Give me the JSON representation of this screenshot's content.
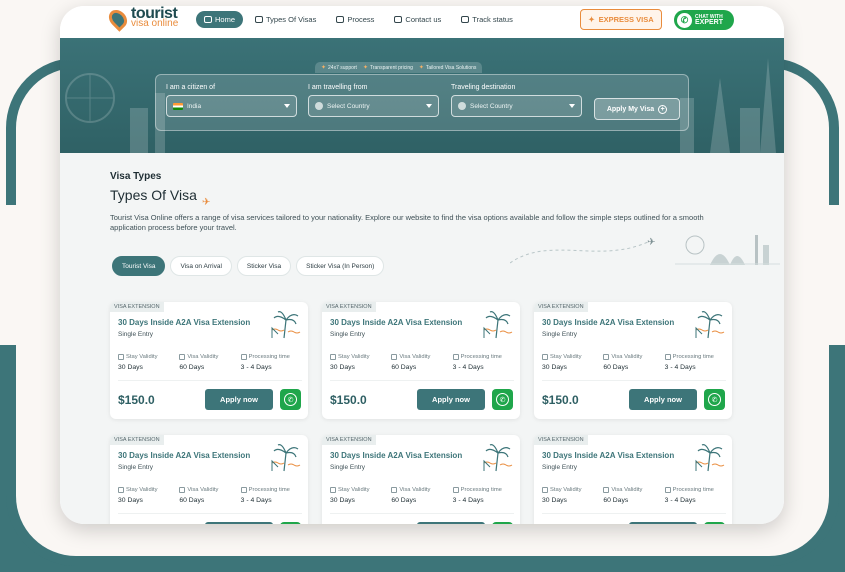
{
  "brand": {
    "name_line1": "tourist",
    "name_line2": "visa online"
  },
  "nav": {
    "items": [
      {
        "label": "Home",
        "active": true
      },
      {
        "label": "Types Of Visas",
        "active": false
      },
      {
        "label": "Process",
        "active": false
      },
      {
        "label": "Contact us",
        "active": false
      },
      {
        "label": "Track status",
        "active": false
      }
    ],
    "express_label": "EXPRESS VISA",
    "chat_line1": "CHAT WITH",
    "chat_line2": "EXPERT"
  },
  "hero": {
    "badges": [
      "24x7 support",
      "Transparent pricing",
      "Tailored Visa Solutions"
    ],
    "citizen": {
      "label": "I am a citizen of",
      "value": "India"
    },
    "from": {
      "label": "I am travelling from",
      "value": "Select Country"
    },
    "destination": {
      "label": "Traveling destination",
      "value": "Select Country"
    },
    "apply_label": "Apply My Visa"
  },
  "section": {
    "eyebrow": "Visa Types",
    "title": "Types Of Visa",
    "description": "Tourist Visa Online offers a range of visa services tailored to your nationality. Explore our website to find the visa options available and follow the simple steps outlined for a smooth application process before your travel."
  },
  "tabs": [
    {
      "label": "Tourist Visa",
      "active": true
    },
    {
      "label": "Visa on Arrival",
      "active": false
    },
    {
      "label": "Sticker Visa",
      "active": false
    },
    {
      "label": "Sticker Visa (In Person)",
      "active": false
    }
  ],
  "cards": [
    {
      "tag": "VISA EXTENSION",
      "title": "30 Days Inside A2A Visa Extension",
      "entry": "Single Entry",
      "stay_label": "Stay Validity",
      "stay": "30 Days",
      "validity_label": "Visa Validity",
      "validity": "60 Days",
      "processing_label": "Processing time",
      "processing": "3 - 4 Days",
      "price": "$150.0",
      "apply_label": "Apply now"
    },
    {
      "tag": "VISA EXTENSION",
      "title": "30 Days Inside A2A Visa Extension",
      "entry": "Single Entry",
      "stay_label": "Stay Validity",
      "stay": "30 Days",
      "validity_label": "Visa Validity",
      "validity": "60 Days",
      "processing_label": "Processing time",
      "processing": "3 - 4 Days",
      "price": "$150.0",
      "apply_label": "Apply now"
    },
    {
      "tag": "VISA EXTENSION",
      "title": "30 Days Inside A2A Visa Extension",
      "entry": "Single Entry",
      "stay_label": "Stay Validity",
      "stay": "30 Days",
      "validity_label": "Visa Validity",
      "validity": "60 Days",
      "processing_label": "Processing time",
      "processing": "3 - 4 Days",
      "price": "$150.0",
      "apply_label": "Apply now"
    },
    {
      "tag": "VISA EXTENSION",
      "title": "30 Days Inside A2A Visa Extension",
      "entry": "Single Entry",
      "stay_label": "Stay Validity",
      "stay": "30 Days",
      "validity_label": "Visa Validity",
      "validity": "60 Days",
      "processing_label": "Processing time",
      "processing": "3 - 4 Days",
      "price": "",
      "apply_label": ""
    },
    {
      "tag": "VISA EXTENSION",
      "title": "30 Days Inside A2A Visa Extension",
      "entry": "Single Entry",
      "stay_label": "Stay Validity",
      "stay": "30 Days",
      "validity_label": "Visa Validity",
      "validity": "60 Days",
      "processing_label": "Processing time",
      "processing": "3 - 4 Days",
      "price": "",
      "apply_label": ""
    },
    {
      "tag": "VISA EXTENSION",
      "title": "30 Days Inside A2A Visa Extension",
      "entry": "Single Entry",
      "stay_label": "Stay Validity",
      "stay": "30 Days",
      "validity_label": "Visa Validity",
      "validity": "60 Days",
      "processing_label": "Processing time",
      "processing": "3 - 4 Days",
      "price": "",
      "apply_label": ""
    }
  ],
  "colors": {
    "primary": "#3d7579",
    "accent": "#e98c3d",
    "whatsapp": "#1fa64b"
  }
}
